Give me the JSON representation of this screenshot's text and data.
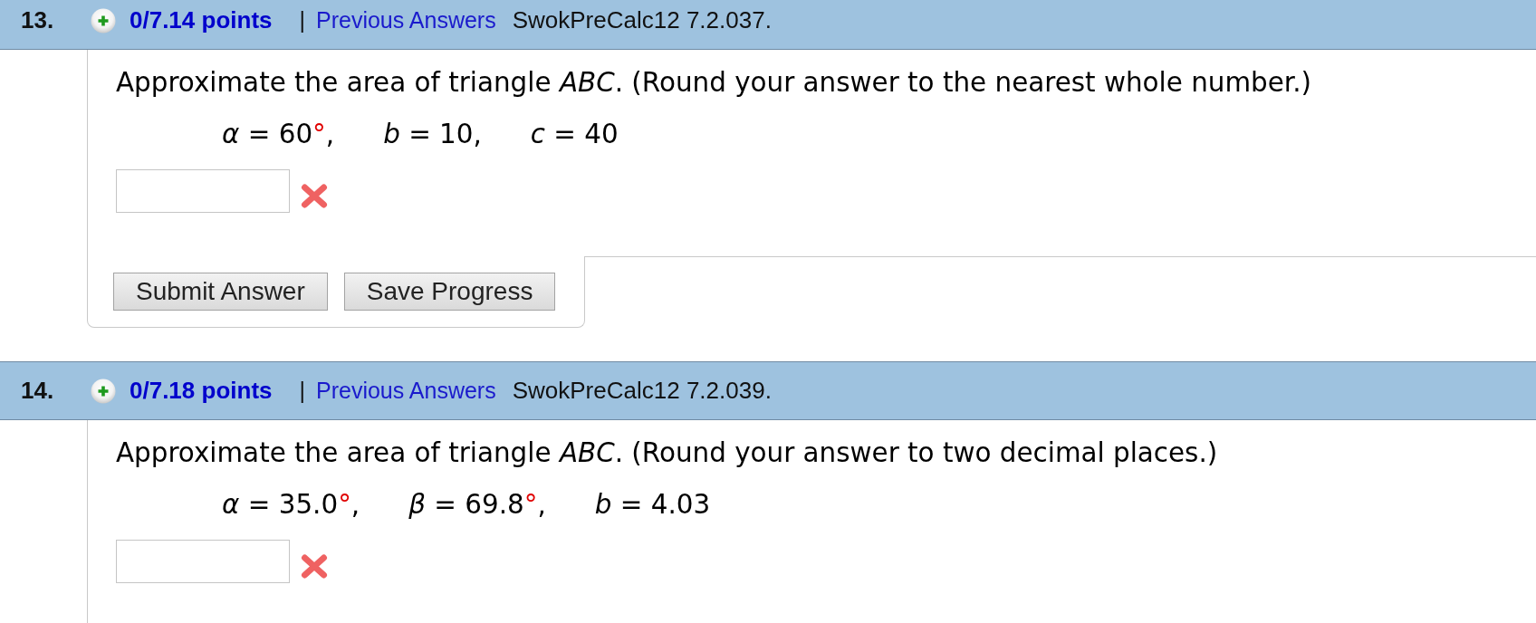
{
  "questions": [
    {
      "number": "13.",
      "points": "0/7.14 points",
      "separator": "|",
      "history_link": "Previous Answers",
      "source": "SwokPreCalc12 7.2.037.",
      "prompt": "Approximate the area of triangle *ABC*. (Round your answer to the nearest whole number.)",
      "givens": [
        {
          "expression": "*α* = 60",
          "unit": "°",
          "punctuation": ","
        },
        {
          "expression": "*b* = 10",
          "punctuation": ","
        },
        {
          "expression": "*c* = 40"
        }
      ],
      "answer": {
        "correct": false
      },
      "buttons": [
        "Submit Answer",
        "Save Progress"
      ]
    },
    {
      "number": "14.",
      "points": "0/7.18 points",
      "separator": "|",
      "history_link": "Previous Answers",
      "source": "SwokPreCalc12 7.2.039.",
      "prompt": "Approximate the area of triangle *ABC*. (Round your answer to two decimal places.)",
      "givens": [
        {
          "expression": "*α* = 35.0",
          "unit": "°",
          "punctuation": ","
        },
        {
          "expression": "*β* = 69.8",
          "unit": "°",
          "punctuation": ","
        },
        {
          "expression": "*b* = 4.03"
        }
      ],
      "answer": {
        "correct": false
      }
    }
  ]
}
